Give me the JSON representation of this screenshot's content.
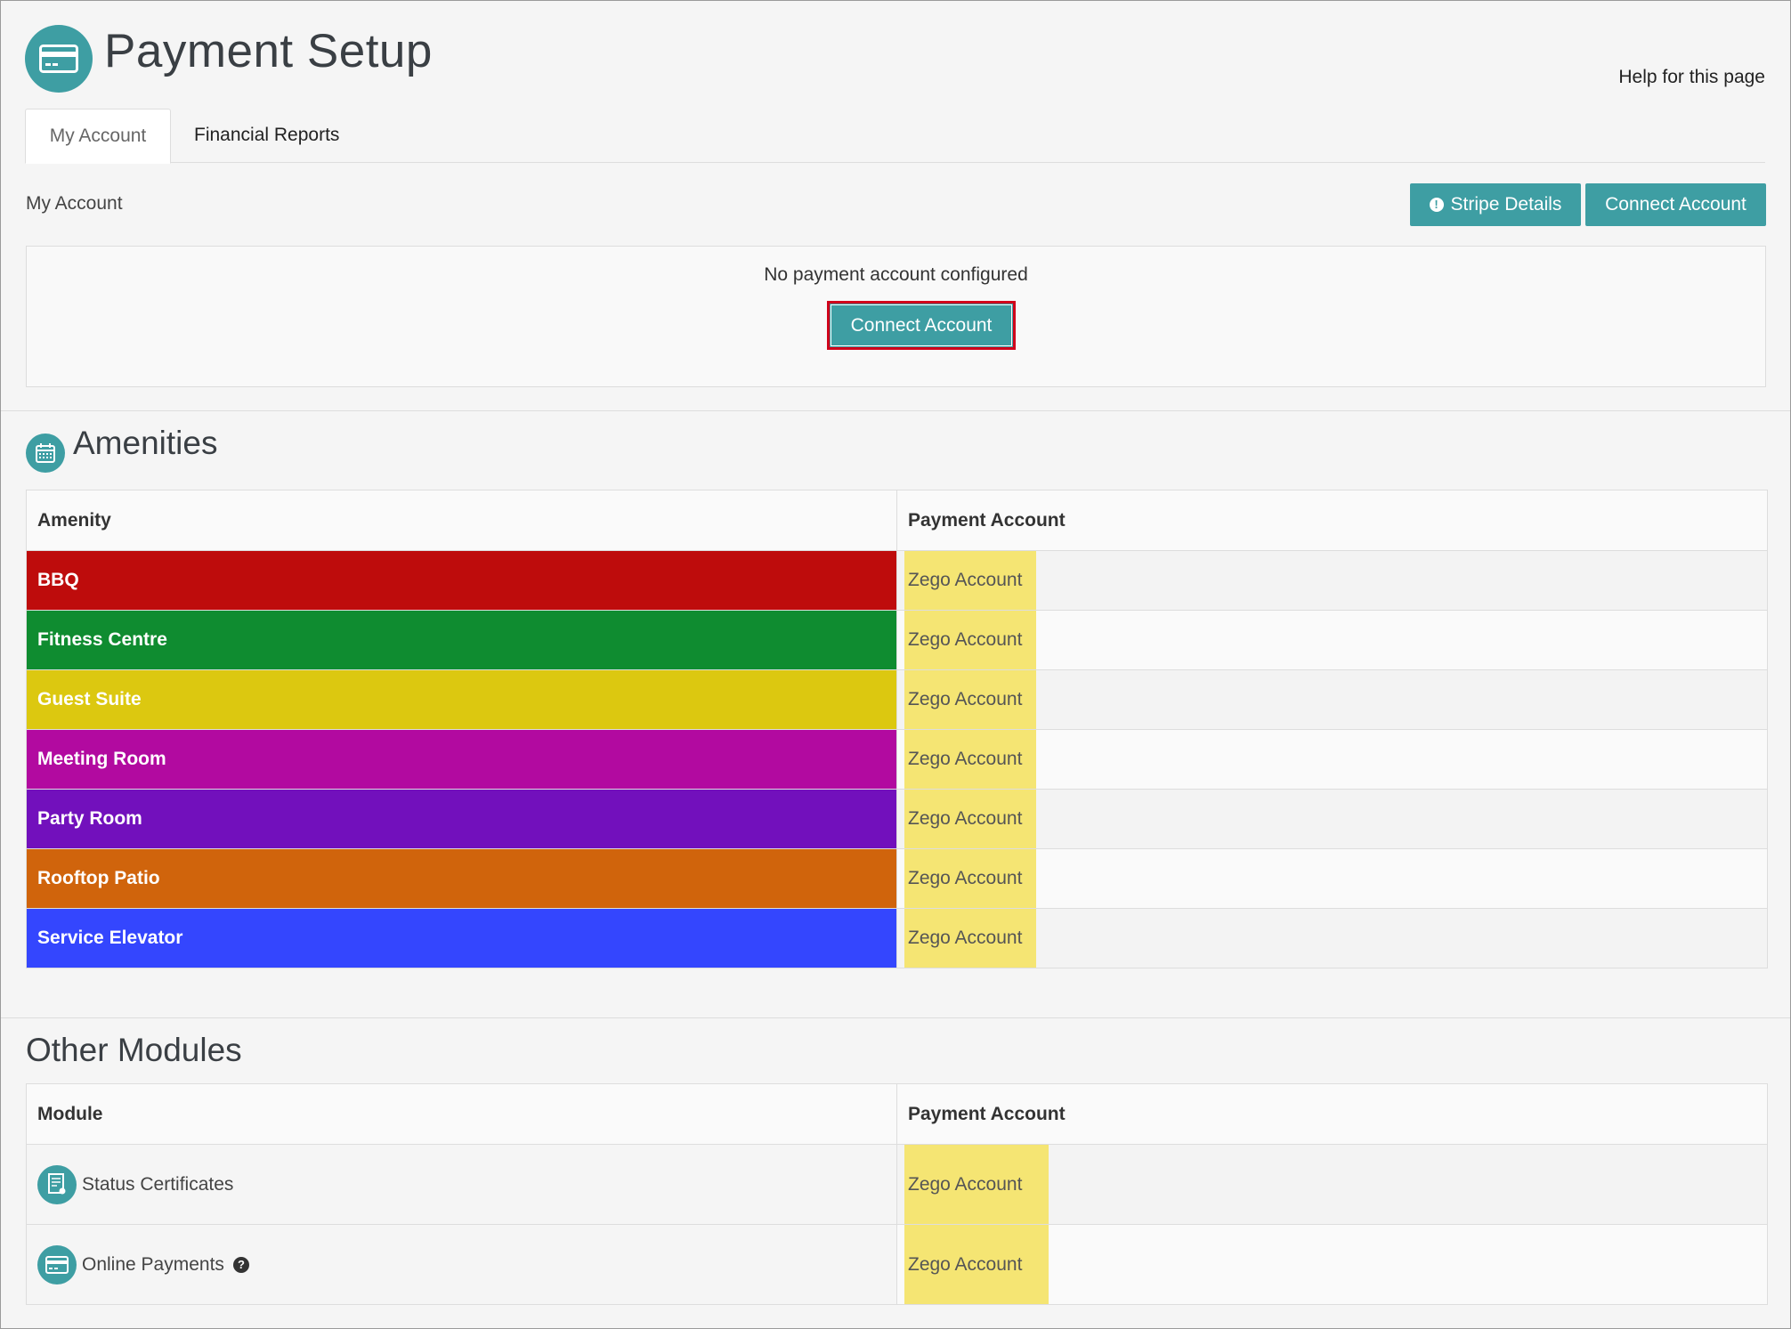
{
  "header": {
    "title": "Payment Setup",
    "help_link": "Help for this page",
    "icon": "credit-card-icon"
  },
  "tabs": [
    {
      "label": "My Account",
      "active": true
    },
    {
      "label": "Financial Reports",
      "active": false
    }
  ],
  "account": {
    "section_label": "My Account",
    "stripe_button": "Stripe Details",
    "connect_button": "Connect Account",
    "empty_message": "No payment account configured",
    "panel_connect_button": "Connect Account"
  },
  "amenities": {
    "title": "Amenities",
    "icon": "calendar-icon",
    "columns": [
      "Amenity",
      "Payment Account"
    ],
    "rows": [
      {
        "name": "BBQ",
        "account": "Zego Account",
        "color": "#be0c0c"
      },
      {
        "name": "Fitness Centre",
        "account": "Zego Account",
        "color": "#0f8c30"
      },
      {
        "name": "Guest Suite",
        "account": "Zego Account",
        "color": "#dcc810"
      },
      {
        "name": "Meeting Room",
        "account": "Zego Account",
        "color": "#b20aa0"
      },
      {
        "name": "Party Room",
        "account": "Zego Account",
        "color": "#7210bc"
      },
      {
        "name": "Rooftop Patio",
        "account": "Zego Account",
        "color": "#d0640c"
      },
      {
        "name": "Service Elevator",
        "account": "Zego Account",
        "color": "#3446fe"
      }
    ]
  },
  "modules": {
    "title": "Other Modules",
    "columns": [
      "Module",
      "Payment Account"
    ],
    "rows": [
      {
        "name": "Status Certificates",
        "account": "Zego Account",
        "icon": "certificate-icon"
      },
      {
        "name": "Online Payments",
        "account": "Zego Account",
        "icon": "credit-card-icon",
        "help": true
      }
    ]
  },
  "colors": {
    "accent": "#3e9ea3",
    "highlight": "#f5e573",
    "focus_outline": "#d0021b"
  }
}
